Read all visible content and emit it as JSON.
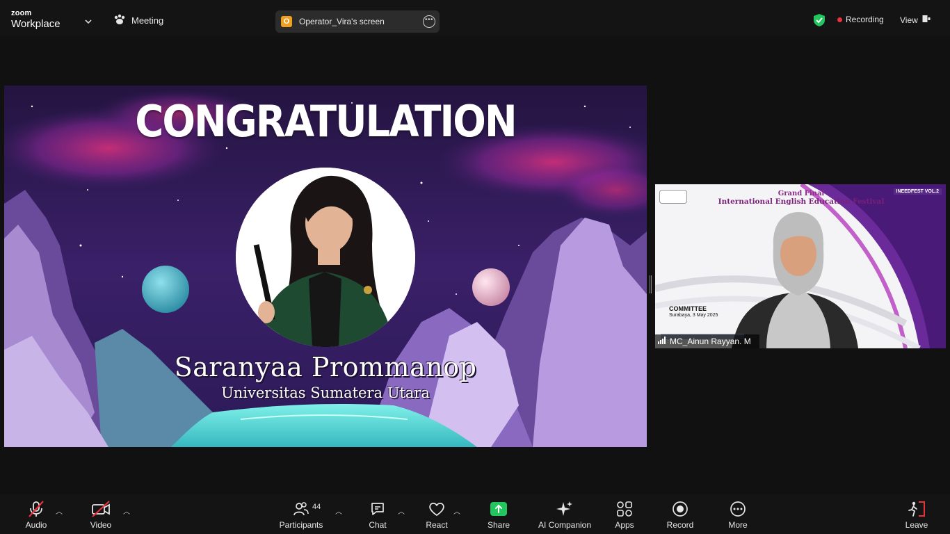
{
  "topbar": {
    "brand_line1": "zoom",
    "brand_line2": "Workplace",
    "meeting_label": "Meeting",
    "screen_owner_initial": "O",
    "screen_title": "Operator_Vira's screen",
    "recording_label": "Recording",
    "view_label": "View"
  },
  "shared_screen": {
    "headline": "CONGRATULATION",
    "winner_name": "Saranyaa Prommanop",
    "winner_university": "Universitas Sumatera Utara"
  },
  "participant_tile": {
    "event_line1": "Grand Final",
    "event_line2": "International English Education Festival",
    "event_badge": "INEEDFEST VOL.2",
    "committee_label": "COMMITTEE",
    "committee_date": "Surabaya, 3 May 2025",
    "participant_name": "MC_Ainun Rayyan. M"
  },
  "toolbar": {
    "audio": "Audio",
    "video": "Video",
    "participants": "Participants",
    "participants_count": "44",
    "chat": "Chat",
    "react": "React",
    "share": "Share",
    "ai_companion": "AI Companion",
    "apps": "Apps",
    "record": "Record",
    "more": "More",
    "leave": "Leave"
  },
  "colors": {
    "share_green": "#22c55e",
    "recording_red": "#e8323c",
    "leave_red": "#e8323c",
    "muted_red": "#e8323c"
  }
}
